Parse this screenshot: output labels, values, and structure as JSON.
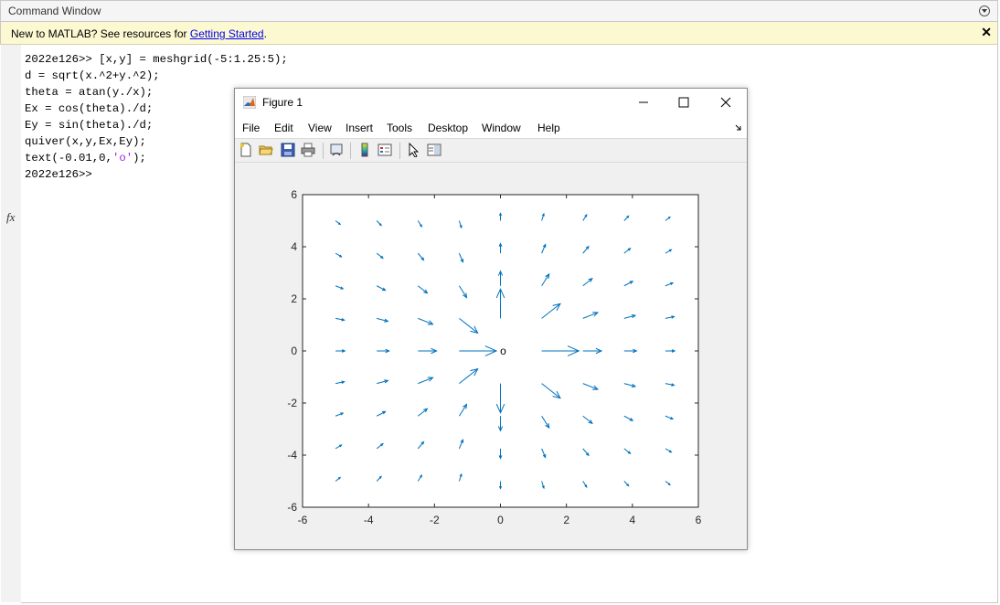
{
  "command_window": {
    "title": "Command Window",
    "banner": {
      "text_before": "New to MATLAB? See resources for ",
      "link": "Getting Started",
      "text_after": ".",
      "close_glyph": "✕"
    },
    "lines": [
      "2022e126>> [x,y] = meshgrid(-5:1.25:5);",
      "d = sqrt(x.^2+y.^2);",
      "theta = atan(y./x);",
      "Ex = cos(theta)./d;",
      "Ey = sin(theta)./d;",
      "quiver(x,y,Ex,Ey);",
      "text(-0.01,0,",
      "2022e126>> "
    ],
    "string_literal": "'o'",
    "line7_tail": ");",
    "fx_label": "fx"
  },
  "figure": {
    "title": "Figure 1",
    "menus": [
      "File",
      "Edit",
      "View",
      "Insert",
      "Tools",
      "Desktop",
      "Window",
      "Help"
    ],
    "toolbar_icons": [
      "new-figure-icon",
      "open-file-icon",
      "save-icon",
      "print-icon",
      "link-plot-icon",
      "colorbar-icon",
      "legend-icon",
      "pointer-icon",
      "property-editor-icon"
    ],
    "accent_color": "#0072bd"
  },
  "chart_data": {
    "type": "quiver",
    "title": "",
    "xlabel": "",
    "ylabel": "",
    "xlim": [
      -6,
      6
    ],
    "ylim": [
      -6,
      6
    ],
    "xticks": [
      -6,
      -4,
      -2,
      0,
      2,
      4,
      6
    ],
    "yticks": [
      -6,
      -4,
      -2,
      0,
      2,
      4,
      6
    ],
    "grid_x": [
      -5,
      -3.75,
      -2.5,
      -1.25,
      0,
      1.25,
      2.5,
      3.75,
      5
    ],
    "grid_y": [
      -5,
      -3.75,
      -2.5,
      -1.25,
      0,
      1.25,
      2.5,
      3.75,
      5
    ],
    "u_formula": "cos(atan(y/x))/sqrt(x^2+y^2)",
    "v_formula": "sin(atan(y/x))/sqrt(x^2+y^2)",
    "annotation": {
      "text": "o",
      "x": -0.01,
      "y": 0
    },
    "color": "#0072bd"
  }
}
